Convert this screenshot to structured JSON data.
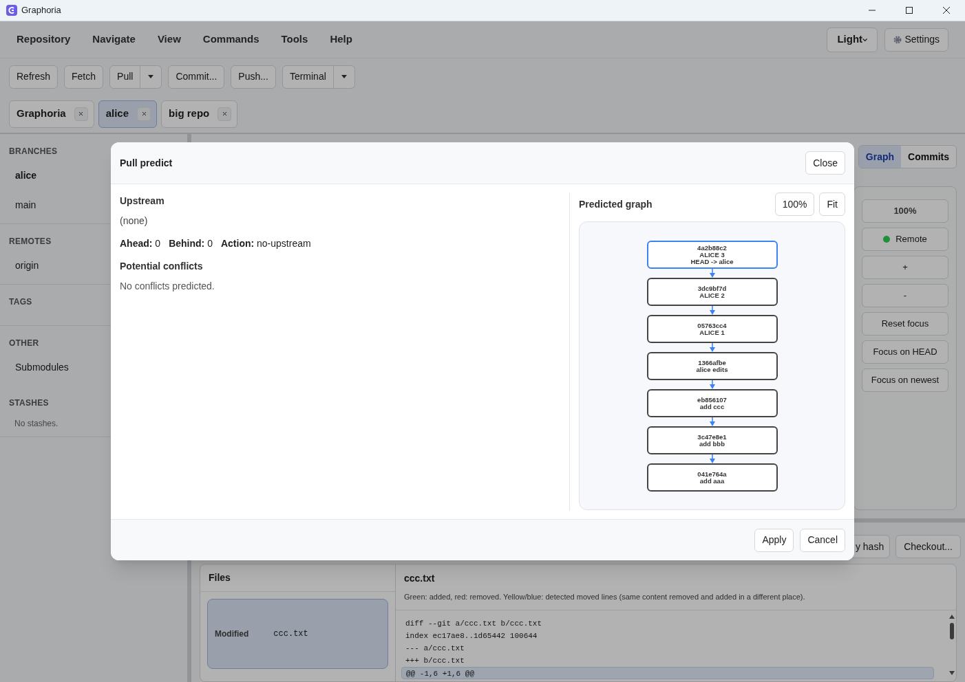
{
  "window": {
    "title": "Graphoria"
  },
  "menu": [
    "Repository",
    "Navigate",
    "View",
    "Commands",
    "Tools",
    "Help"
  ],
  "theme_select": {
    "value": "Light"
  },
  "settings_button": "Settings",
  "toolbar": [
    {
      "label": "Refresh",
      "kind": "button"
    },
    {
      "label": "Fetch",
      "kind": "button"
    },
    {
      "label": "Pull",
      "kind": "split"
    },
    {
      "label": "Commit...",
      "kind": "button"
    },
    {
      "label": "Push...",
      "kind": "button"
    },
    {
      "label": "Terminal",
      "kind": "split"
    }
  ],
  "repo_tabs": [
    {
      "label": "Graphoria",
      "selected": false
    },
    {
      "label": "alice",
      "selected": true
    },
    {
      "label": "big repo",
      "selected": false
    }
  ],
  "sidebar": {
    "sections": [
      {
        "title": "BRANCHES",
        "items": [
          {
            "label": "alice",
            "selected": true
          },
          {
            "label": "main",
            "selected": false
          }
        ]
      },
      {
        "title": "REMOTES",
        "items": [
          {
            "label": "origin",
            "selected": false
          }
        ]
      },
      {
        "title": "TAGS"
      },
      {
        "title": "OTHER",
        "items": [
          {
            "label": "Submodules",
            "selected": false
          }
        ]
      },
      {
        "title": "STASHES",
        "empty_text": "No stashes."
      }
    ]
  },
  "view_tabs": [
    {
      "label": "Graph",
      "selected": true
    },
    {
      "label": "Commits",
      "selected": false
    }
  ],
  "graph_controls": [
    {
      "label": "100%",
      "kind": "zoom"
    },
    {
      "label": "Remote",
      "kind": "status",
      "color": "#1f8f3a"
    },
    {
      "label": "+",
      "kind": "button"
    },
    {
      "label": "-",
      "kind": "button"
    },
    {
      "label": "Reset focus",
      "kind": "button"
    },
    {
      "label": "Focus on HEAD",
      "kind": "button"
    },
    {
      "label": "Focus on newest",
      "kind": "button"
    }
  ],
  "commit_actions": [
    "y hash",
    "Checkout..."
  ],
  "files_panel": {
    "title": "Files",
    "files": [
      {
        "status": "Modified",
        "name": "ccc.txt",
        "selected": true
      }
    ]
  },
  "diff": {
    "title": "ccc.txt",
    "legend": "Green: added, red: removed. Yellow/blue: detected moved lines (same content removed and added in a different place).",
    "lines": [
      {
        "text": "diff --git a/ccc.txt b/ccc.txt",
        "kind": "header"
      },
      {
        "text": "index ec17ae8..1d65442 100644",
        "kind": "header"
      },
      {
        "text": "--- a/ccc.txt",
        "kind": "header"
      },
      {
        "text": "+++ b/ccc.txt",
        "kind": "header"
      },
      {
        "text": "@@ -1,6 +1,6 @@",
        "kind": "hunk"
      }
    ]
  },
  "dialog": {
    "title": "Pull predict",
    "close": "Close",
    "upstream_heading": "Upstream",
    "upstream_value": "(none)",
    "stats": [
      {
        "label": "Ahead:",
        "value": "0"
      },
      {
        "label": "Behind:",
        "value": "0"
      },
      {
        "label": "Action:",
        "value": "no-upstream"
      }
    ],
    "conflicts_heading": "Potential conflicts",
    "conflicts_text": "No conflicts predicted.",
    "graph_title": "Predicted graph",
    "zoom_buttons": [
      "100%",
      "Fit"
    ],
    "nodes": [
      {
        "hash": "4a2b88c2",
        "message": "ALICE 3",
        "ref": "HEAD -> alice",
        "head": true
      },
      {
        "hash": "3dc9bf7d",
        "message": "ALICE 2",
        "head": false
      },
      {
        "hash": "05763cc4",
        "message": "ALICE 1",
        "head": false
      },
      {
        "hash": "1366afbe",
        "message": "alice edits",
        "head": false
      },
      {
        "hash": "eb856107",
        "message": "add ccc",
        "head": false
      },
      {
        "hash": "3c47e8e1",
        "message": "add bbb",
        "head": false
      },
      {
        "hash": "041e764a",
        "message": "add aaa",
        "head": false
      }
    ],
    "buttons": [
      "Apply",
      "Cancel"
    ]
  }
}
